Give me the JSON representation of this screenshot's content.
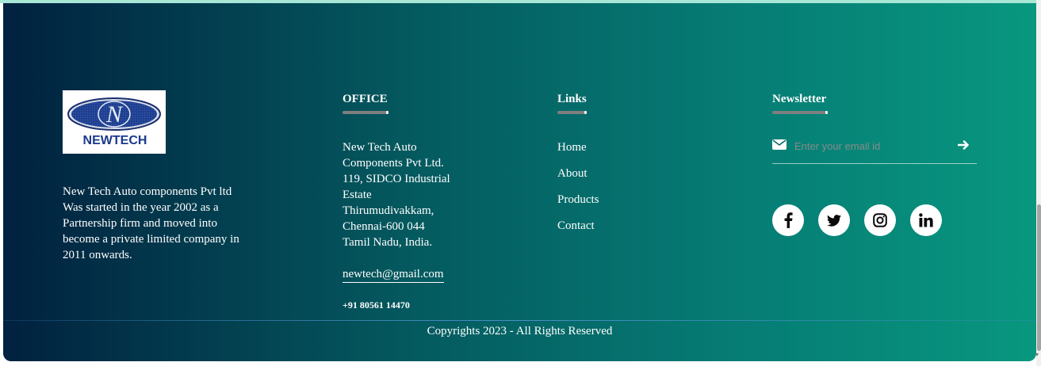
{
  "company": {
    "logo_text": "NEWTECH",
    "about_lines": [
      "New Tech Auto components Pvt ltd",
      "Was started in the year 2002 as a",
      "Partnership firm and moved into",
      "become a private limited company in",
      "2011 onwards."
    ]
  },
  "office": {
    "title": "OFFICE",
    "address_lines": [
      "New Tech Auto",
      "Components Pvt Ltd.",
      "119, SIDCO Industrial",
      "Estate",
      "Thirumudivakkam,",
      "Chennai-600 044",
      "Tamil Nadu, India."
    ],
    "email": "newtech@gmail.com",
    "phone": "+91 80561 14470"
  },
  "links": {
    "title": "Links",
    "items": [
      "Home",
      "About",
      "Products",
      "Contact"
    ]
  },
  "newsletter": {
    "title": "Newsletter",
    "placeholder": "Enter your email id",
    "value": "",
    "icons": {
      "field": "envelope-icon",
      "submit": "arrow-right-icon"
    }
  },
  "socials": [
    "facebook-icon",
    "twitter-icon",
    "instagram-icon",
    "linkedin-icon"
  ],
  "footer": {
    "copyright": "Copyrights 2023 - All Rights Reserved"
  },
  "colors": {
    "gradient_start": "#01213f",
    "gradient_end": "#08977f",
    "text": "#ffffff",
    "logo_blue": "#1a3a8a"
  }
}
